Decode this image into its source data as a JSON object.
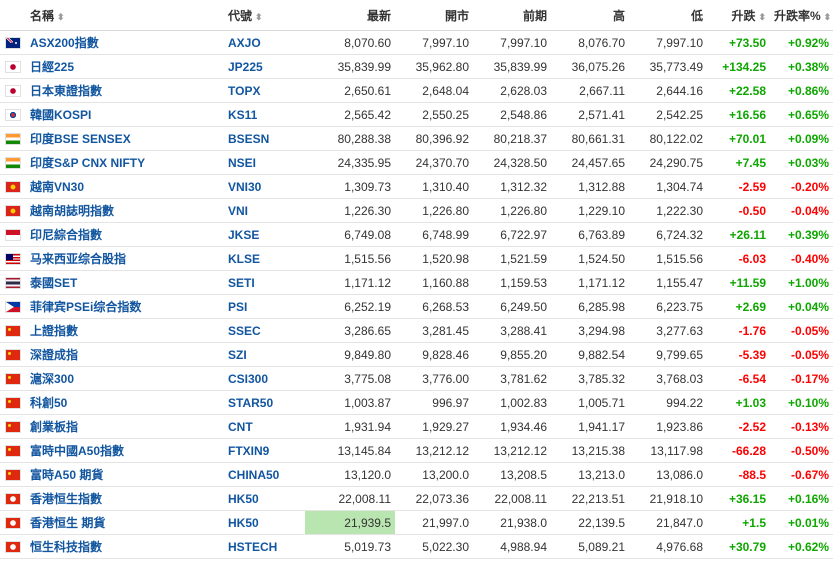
{
  "columns": {
    "name": "名稱",
    "symbol": "代號",
    "last": "最新",
    "open": "開市",
    "prev": "前期",
    "high": "高",
    "low": "低",
    "change": "升跌",
    "change_pct": "升跌率%"
  },
  "colors": {
    "up": "#0ea600",
    "down": "#ff0000",
    "link": "#1256a0",
    "highlight": "#b9e6b0"
  },
  "rows": [
    {
      "flag": "australia-flag-icon",
      "name": "ASX200指數",
      "symbol": "AXJO",
      "last": "8,070.60",
      "open": "7,997.10",
      "prev": "7,997.10",
      "high": "8,076.70",
      "low": "7,997.10",
      "change": "+73.50",
      "change_pct": "+0.92%",
      "dir": "up"
    },
    {
      "flag": "japan-flag-icon",
      "name": "日經225",
      "symbol": "JP225",
      "last": "35,839.99",
      "open": "35,962.80",
      "prev": "35,839.99",
      "high": "36,075.26",
      "low": "35,773.49",
      "change": "+134.25",
      "change_pct": "+0.38%",
      "dir": "up"
    },
    {
      "flag": "japan-flag-icon",
      "name": "日本東證指數",
      "symbol": "TOPX",
      "last": "2,650.61",
      "open": "2,648.04",
      "prev": "2,628.03",
      "high": "2,667.11",
      "low": "2,644.16",
      "change": "+22.58",
      "change_pct": "+0.86%",
      "dir": "up"
    },
    {
      "flag": "south-korea-flag-icon",
      "name": "韓國KOSPI",
      "symbol": "KS11",
      "last": "2,565.42",
      "open": "2,550.25",
      "prev": "2,548.86",
      "high": "2,571.41",
      "low": "2,542.25",
      "change": "+16.56",
      "change_pct": "+0.65%",
      "dir": "up"
    },
    {
      "flag": "india-flag-icon",
      "name": "印度BSE SENSEX",
      "symbol": "BSESN",
      "last": "80,288.38",
      "open": "80,396.92",
      "prev": "80,218.37",
      "high": "80,661.31",
      "low": "80,122.02",
      "change": "+70.01",
      "change_pct": "+0.09%",
      "dir": "up"
    },
    {
      "flag": "india-flag-icon",
      "name": "印度S&P CNX NIFTY",
      "symbol": "NSEI",
      "last": "24,335.95",
      "open": "24,370.70",
      "prev": "24,328.50",
      "high": "24,457.65",
      "low": "24,290.75",
      "change": "+7.45",
      "change_pct": "+0.03%",
      "dir": "up"
    },
    {
      "flag": "vietnam-flag-icon",
      "name": "越南VN30",
      "symbol": "VNI30",
      "last": "1,309.73",
      "open": "1,310.40",
      "prev": "1,312.32",
      "high": "1,312.88",
      "low": "1,304.74",
      "change": "-2.59",
      "change_pct": "-0.20%",
      "dir": "down"
    },
    {
      "flag": "vietnam-flag-icon",
      "name": "越南胡誌明指數",
      "symbol": "VNI",
      "last": "1,226.30",
      "open": "1,226.80",
      "prev": "1,226.80",
      "high": "1,229.10",
      "low": "1,222.30",
      "change": "-0.50",
      "change_pct": "-0.04%",
      "dir": "down"
    },
    {
      "flag": "indonesia-flag-icon",
      "name": "印尼綜合指數",
      "symbol": "JKSE",
      "last": "6,749.08",
      "open": "6,748.99",
      "prev": "6,722.97",
      "high": "6,763.89",
      "low": "6,724.32",
      "change": "+26.11",
      "change_pct": "+0.39%",
      "dir": "up"
    },
    {
      "flag": "malaysia-flag-icon",
      "name": "马来西亚综合股指",
      "symbol": "KLSE",
      "last": "1,515.56",
      "open": "1,520.98",
      "prev": "1,521.59",
      "high": "1,524.50",
      "low": "1,515.56",
      "change": "-6.03",
      "change_pct": "-0.40%",
      "dir": "down"
    },
    {
      "flag": "thailand-flag-icon",
      "name": "泰國SET",
      "symbol": "SETI",
      "last": "1,171.12",
      "open": "1,160.88",
      "prev": "1,159.53",
      "high": "1,171.12",
      "low": "1,155.47",
      "change": "+11.59",
      "change_pct": "+1.00%",
      "dir": "up"
    },
    {
      "flag": "philippines-flag-icon",
      "name": "菲律宾PSEi综合指数",
      "symbol": "PSI",
      "last": "6,252.19",
      "open": "6,268.53",
      "prev": "6,249.50",
      "high": "6,285.98",
      "low": "6,223.75",
      "change": "+2.69",
      "change_pct": "+0.04%",
      "dir": "up"
    },
    {
      "flag": "china-flag-icon",
      "name": "上證指數",
      "symbol": "SSEC",
      "last": "3,286.65",
      "open": "3,281.45",
      "prev": "3,288.41",
      "high": "3,294.98",
      "low": "3,277.63",
      "change": "-1.76",
      "change_pct": "-0.05%",
      "dir": "down"
    },
    {
      "flag": "china-flag-icon",
      "name": "深證成指",
      "symbol": "SZI",
      "last": "9,849.80",
      "open": "9,828.46",
      "prev": "9,855.20",
      "high": "9,882.54",
      "low": "9,799.65",
      "change": "-5.39",
      "change_pct": "-0.05%",
      "dir": "down"
    },
    {
      "flag": "china-flag-icon",
      "name": "滬深300",
      "symbol": "CSI300",
      "last": "3,775.08",
      "open": "3,776.00",
      "prev": "3,781.62",
      "high": "3,785.32",
      "low": "3,768.03",
      "change": "-6.54",
      "change_pct": "-0.17%",
      "dir": "down"
    },
    {
      "flag": "china-flag-icon",
      "name": "科創50",
      "symbol": "STAR50",
      "last": "1,003.87",
      "open": "996.97",
      "prev": "1,002.83",
      "high": "1,005.71",
      "low": "994.22",
      "change": "+1.03",
      "change_pct": "+0.10%",
      "dir": "up"
    },
    {
      "flag": "china-flag-icon",
      "name": "創業板指",
      "symbol": "CNT",
      "last": "1,931.94",
      "open": "1,929.27",
      "prev": "1,934.46",
      "high": "1,941.17",
      "low": "1,923.86",
      "change": "-2.52",
      "change_pct": "-0.13%",
      "dir": "down"
    },
    {
      "flag": "china-flag-icon",
      "name": "富時中國A50指數",
      "symbol": "FTXIN9",
      "last": "13,145.84",
      "open": "13,212.12",
      "prev": "13,212.12",
      "high": "13,215.38",
      "low": "13,117.98",
      "change": "-66.28",
      "change_pct": "-0.50%",
      "dir": "down"
    },
    {
      "flag": "china-flag-icon",
      "name": "富時A50 期貨",
      "symbol": "CHINA50",
      "last": "13,120.0",
      "open": "13,200.0",
      "prev": "13,208.5",
      "high": "13,213.0",
      "low": "13,086.0",
      "change": "-88.5",
      "change_pct": "-0.67%",
      "dir": "down"
    },
    {
      "flag": "hong-kong-flag-icon",
      "name": "香港恒生指數",
      "symbol": "HK50",
      "last": "22,008.11",
      "open": "22,073.36",
      "prev": "22,008.11",
      "high": "22,213.51",
      "low": "21,918.10",
      "change": "+36.15",
      "change_pct": "+0.16%",
      "dir": "up"
    },
    {
      "flag": "hong-kong-flag-icon",
      "name": "香港恒生 期貨",
      "symbol": "HK50",
      "last": "21,939.5",
      "open": "21,997.0",
      "prev": "21,938.0",
      "high": "22,139.5",
      "low": "21,847.0",
      "change": "+1.5",
      "change_pct": "+0.01%",
      "dir": "up",
      "last_highlight": true
    },
    {
      "flag": "hong-kong-flag-icon",
      "name": "恒生科技指數",
      "symbol": "HSTECH",
      "last": "5,019.73",
      "open": "5,022.30",
      "prev": "4,988.94",
      "high": "5,089.21",
      "low": "4,976.68",
      "change": "+30.79",
      "change_pct": "+0.62%",
      "dir": "up"
    }
  ]
}
